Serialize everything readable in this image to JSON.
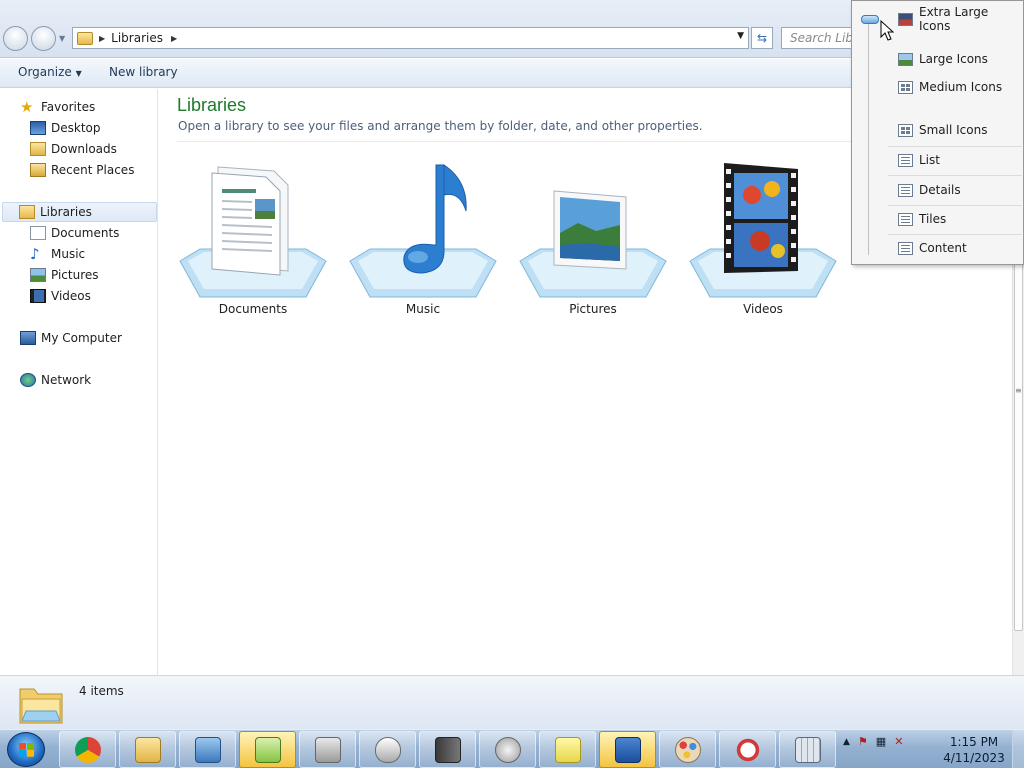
{
  "address_bar": {
    "crumbs": [
      "Libraries"
    ],
    "search_placeholder": "Search Libraries"
  },
  "command_bar": {
    "organize": "Organize",
    "new_library": "New library"
  },
  "nav": {
    "favorites": {
      "label": "Favorites",
      "items": [
        "Desktop",
        "Downloads",
        "Recent Places"
      ]
    },
    "libraries": {
      "label": "Libraries",
      "items": [
        "Documents",
        "Music",
        "Pictures",
        "Videos"
      ]
    },
    "computer": "My Computer",
    "network": "Network"
  },
  "content": {
    "title": "Libraries",
    "subtitle": "Open a library to see your files and arrange them by folder, date, and other properties.",
    "libraries": [
      "Documents",
      "Music",
      "Pictures",
      "Videos"
    ]
  },
  "details": {
    "item_count": "4 items"
  },
  "view_menu": {
    "items": [
      "Extra Large Icons",
      "Large Icons",
      "Medium Icons",
      "Small Icons",
      "List",
      "Details",
      "Tiles",
      "Content"
    ],
    "selected": "Extra Large Icons"
  },
  "taskbar": {
    "time": "1:15 PM",
    "date": "4/11/2023"
  },
  "colors": {
    "title_green": "#1e7a2a",
    "accent_blue": "#3a6fb0",
    "taskbar": "#94b1d1"
  }
}
